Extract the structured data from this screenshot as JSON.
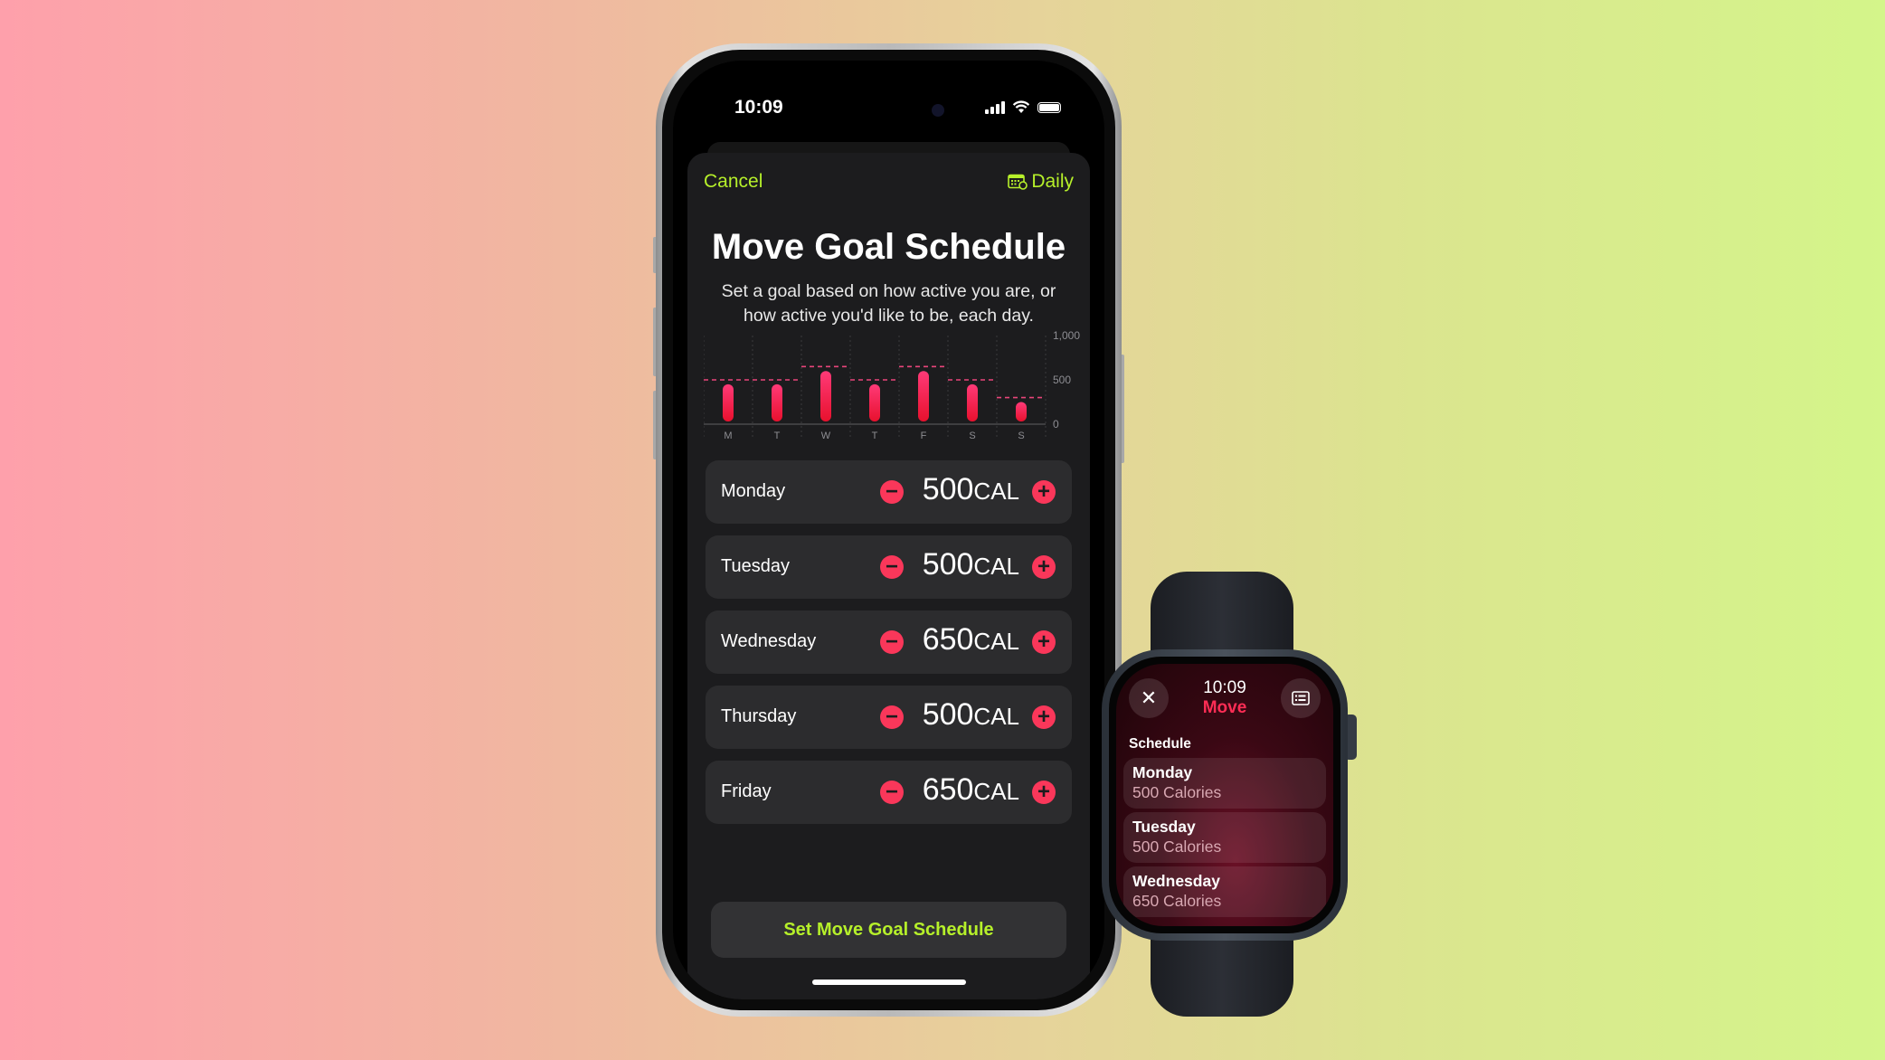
{
  "background": {
    "left_color": "#fea0ab",
    "right_color": "#d4f58a"
  },
  "phone": {
    "status_bar": {
      "time": "10:09",
      "icons": [
        "cellular-signal-icon",
        "wifi-icon",
        "battery-icon"
      ]
    },
    "nav": {
      "cancel_label": "Cancel",
      "daily_label": "Daily",
      "daily_icon": "calendar-clock-icon"
    },
    "title": "Move Goal Schedule",
    "subtitle": "Set a goal based on how active you are, or how active you'd like to be, each day.",
    "schedule": [
      {
        "day": "Monday",
        "value": "500",
        "unit": "CAL"
      },
      {
        "day": "Tuesday",
        "value": "500",
        "unit": "CAL"
      },
      {
        "day": "Wednesday",
        "value": "650",
        "unit": "CAL"
      },
      {
        "day": "Thursday",
        "value": "500",
        "unit": "CAL"
      },
      {
        "day": "Friday",
        "value": "650",
        "unit": "CAL"
      }
    ],
    "cta_label": "Set Move Goal Schedule",
    "accent_color": "#b6f02a",
    "ring_color": "#fa375a"
  },
  "chart_data": {
    "type": "bar",
    "title": "",
    "categories": [
      "M",
      "T",
      "W",
      "T",
      "F",
      "S",
      "S"
    ],
    "series": [
      {
        "name": "goal",
        "values": [
          500,
          500,
          650,
          500,
          650,
          500,
          300
        ]
      },
      {
        "name": "bar",
        "values": [
          450,
          450,
          600,
          450,
          600,
          450,
          250
        ]
      }
    ],
    "yticks": [
      "1,000",
      "500",
      "0"
    ],
    "ylim": [
      0,
      1000
    ],
    "grid": true,
    "xlabel": "",
    "ylabel": ""
  },
  "watch": {
    "time": "10:09",
    "app_title": "Move",
    "section_label": "Schedule",
    "close_icon": "close-icon",
    "list_icon": "list-icon",
    "items": [
      {
        "day": "Monday",
        "calories": "500 Calories"
      },
      {
        "day": "Tuesday",
        "calories": "500 Calories"
      },
      {
        "day": "Wednesday",
        "calories": "650 Calories"
      }
    ]
  }
}
